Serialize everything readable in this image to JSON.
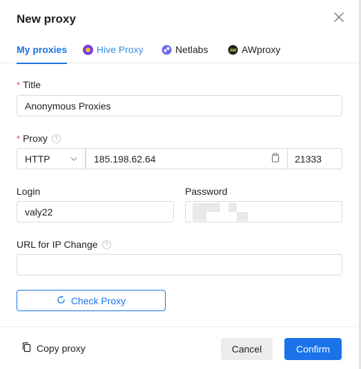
{
  "dialog": {
    "title": "New proxy"
  },
  "tabs": [
    {
      "label": "My proxies",
      "active": true
    },
    {
      "label": "Hive Proxy",
      "icon": "hive-proxy-icon"
    },
    {
      "label": "Netlabs",
      "icon": "netlabs-icon"
    },
    {
      "label": "AWproxy",
      "icon": "awproxy-icon"
    }
  ],
  "form": {
    "title_label": "Title",
    "title_value": "Anonymous Proxies",
    "proxy_label": "Proxy",
    "protocol_value": "HTTP",
    "host_value": "185.198.62.64",
    "port_value": "21333",
    "login_label": "Login",
    "login_value": "valy22",
    "password_label": "Password",
    "url_label": "URL for IP Change",
    "url_value": "",
    "required_mark": "*",
    "help_glyph": "?"
  },
  "actions": {
    "check_proxy": "Check Proxy",
    "copy_proxy": "Copy proxy",
    "cancel": "Cancel",
    "confirm": "Confirm"
  },
  "icons": {
    "aw_badge_text": "AW"
  },
  "colors": {
    "accent": "#1a73e8",
    "required": "#e04040",
    "hive": "#7b3fe4",
    "netlabs": "#6b6bf0"
  }
}
